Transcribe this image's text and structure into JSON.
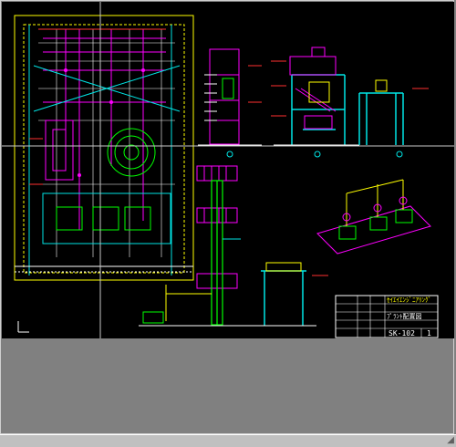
{
  "window": {
    "background": "#808080",
    "canvas_background": "#000000"
  },
  "title_block": {
    "company": "ｾｲｴｲｴﾝｼﾞﾆｱﾘﾝｸﾞ",
    "drawing_title": "ﾌﾟﾗﾝﾄ配置図",
    "drawing_number": "SK-102",
    "sheet": "1"
  },
  "colors": {
    "yellow": "#ffff00",
    "magenta": "#ff00ff",
    "cyan": "#00e5e5",
    "white": "#ffffff",
    "green": "#00ff00",
    "red": "#ff3030"
  },
  "icons": {
    "status_grip": "size-grip-icon"
  }
}
